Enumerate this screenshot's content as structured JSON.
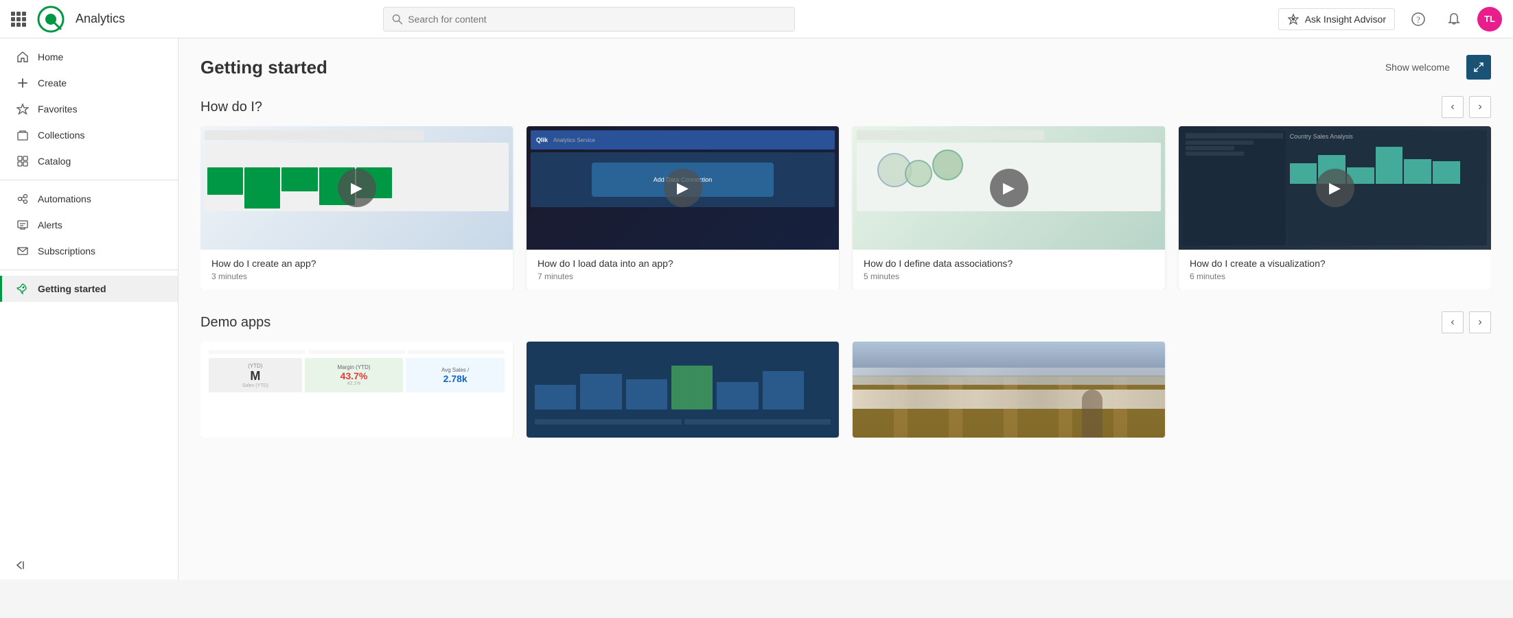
{
  "topnav": {
    "app_name": "Analytics",
    "search_placeholder": "Search for content",
    "insight_btn_label": "Ask Insight Advisor",
    "avatar_initials": "TL"
  },
  "sidebar": {
    "items": [
      {
        "id": "home",
        "label": "Home",
        "icon": "home"
      },
      {
        "id": "create",
        "label": "Create",
        "icon": "plus"
      },
      {
        "id": "favorites",
        "label": "Favorites",
        "icon": "star"
      },
      {
        "id": "collections",
        "label": "Collections",
        "icon": "collections"
      },
      {
        "id": "catalog",
        "label": "Catalog",
        "icon": "catalog"
      },
      {
        "id": "automations",
        "label": "Automations",
        "icon": "automations"
      },
      {
        "id": "alerts",
        "label": "Alerts",
        "icon": "alerts"
      },
      {
        "id": "subscriptions",
        "label": "Subscriptions",
        "icon": "subscriptions"
      },
      {
        "id": "getting-started",
        "label": "Getting started",
        "icon": "rocket",
        "active": true
      }
    ],
    "collapse_label": ""
  },
  "main": {
    "page_title": "Getting started",
    "show_welcome_label": "Show welcome",
    "how_do_i_title": "How do I?",
    "demo_apps_title": "Demo apps",
    "videos": [
      {
        "title": "How do I create an app?",
        "duration": "3 minutes"
      },
      {
        "title": "How do I load data into an app?",
        "duration": "7 minutes"
      },
      {
        "title": "How do I define data associations?",
        "duration": "5 minutes"
      },
      {
        "title": "How do I create a visualization?",
        "duration": "6 minutes"
      }
    ],
    "demo_apps": [
      {
        "id": "sales",
        "type": "kpi"
      },
      {
        "id": "margin",
        "type": "kpi2"
      },
      {
        "id": "warehouse",
        "type": "image"
      }
    ],
    "kpi": {
      "ytd_label": "(YTD)",
      "ytd_value": "M",
      "ytd_sub": "Sales (YTD)",
      "margin_label": "Margin (YTD)",
      "margin_value": "43.7%",
      "margin_sub": "42.1%",
      "avg_label": "Avg Sales /",
      "avg_value": "2.78k"
    }
  }
}
